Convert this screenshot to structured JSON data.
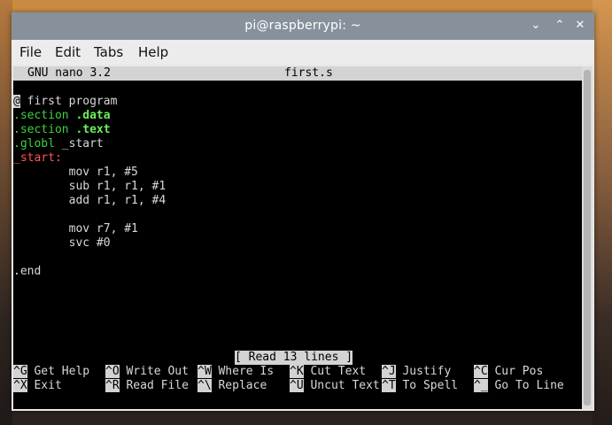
{
  "window": {
    "title": "pi@raspberrypi: ~"
  },
  "menu": [
    "File",
    "Edit",
    "Tabs",
    "Help"
  ],
  "nano": {
    "version": "GNU nano 3.2",
    "filename": "first.s",
    "status": "[ Read 13 lines ]"
  },
  "code": {
    "l1_cursor": "@",
    "l1_rest": " first program",
    "l2_kw": ".section",
    "l2_arg": ".data",
    "l3_kw": ".section",
    "l3_arg": ".text",
    "l4_kw": ".globl",
    "l4_arg": " _start",
    "l5": "_start:",
    "l6": "        mov r1, #5",
    "l7": "        sub r1, r1, #1",
    "l8": "        add r1, r1, #4",
    "l10": "        mov r7, #1",
    "l11": "        svc #0",
    "l13": ".end"
  },
  "shortcuts": {
    "row1": [
      {
        "key": "^G",
        "label": "Get Help"
      },
      {
        "key": "^O",
        "label": "Write Out"
      },
      {
        "key": "^W",
        "label": "Where Is"
      },
      {
        "key": "^K",
        "label": "Cut Text"
      },
      {
        "key": "^J",
        "label": "Justify"
      },
      {
        "key": "^C",
        "label": "Cur Pos"
      }
    ],
    "row2": [
      {
        "key": "^X",
        "label": "Exit"
      },
      {
        "key": "^R",
        "label": "Read File"
      },
      {
        "key": "^\\",
        "label": "Replace"
      },
      {
        "key": "^U",
        "label": "Uncut Text"
      },
      {
        "key": "^T",
        "label": "To Spell"
      },
      {
        "key": "^_",
        "label": "Go To Line"
      }
    ]
  }
}
